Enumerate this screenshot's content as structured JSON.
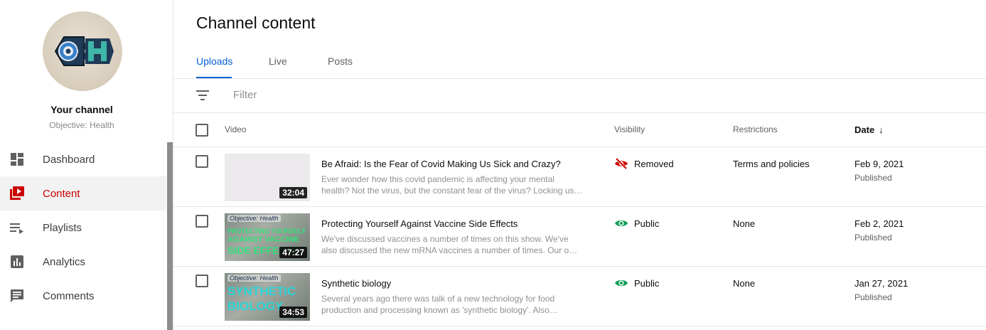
{
  "sidebar": {
    "your_channel": "Your channel",
    "channel_name": "Objective: Health",
    "items": [
      {
        "label": "Dashboard",
        "icon": "dashboard-icon"
      },
      {
        "label": "Content",
        "icon": "content-icon",
        "active": true
      },
      {
        "label": "Playlists",
        "icon": "playlists-icon"
      },
      {
        "label": "Analytics",
        "icon": "analytics-icon"
      },
      {
        "label": "Comments",
        "icon": "comments-icon"
      }
    ]
  },
  "main": {
    "title": "Channel content",
    "tabs": [
      {
        "label": "Uploads",
        "active": true
      },
      {
        "label": "Live"
      },
      {
        "label": "Posts"
      }
    ],
    "filter": {
      "placeholder": "Filter"
    },
    "columns": {
      "video": "Video",
      "visibility": "Visibility",
      "restrictions": "Restrictions",
      "date": "Date"
    },
    "videos": [
      {
        "title": "Be Afraid: Is the Fear of Covid Making Us Sick and Crazy?",
        "description_line1": "Ever wonder how this covid pandemic is affecting your mental",
        "description_line2": "health? Not the virus, but the constant fear of the virus? Locking us…",
        "duration": "32:04",
        "visibility": "Removed",
        "visibility_icon": "visibility-off-icon",
        "restrictions": "Terms and policies",
        "date": "Feb 9, 2021",
        "status": "Published"
      },
      {
        "title": "Protecting Yourself Against Vaccine Side Effects",
        "description_line1": "We've discussed vaccines a number of times on this show. We've",
        "description_line2": "also discussed the new mRNA vaccines a number of times. Our o…",
        "duration": "47:27",
        "visibility": "Public",
        "visibility_icon": "eye-icon",
        "restrictions": "None",
        "date": "Feb 2, 2021",
        "status": "Published",
        "thumb_text": [
          "PROTECTING YOURSELF",
          "AGAINST VACCINE",
          "SIDE EFFECTS"
        ]
      },
      {
        "title": "Synthetic biology",
        "description_line1": "Several years ago there was talk of a new technology for food",
        "description_line2": "production and processing known as 'synthetic biology'. Also…",
        "duration": "34:53",
        "visibility": "Public",
        "visibility_icon": "eye-icon",
        "restrictions": "None",
        "date": "Jan 27, 2021",
        "status": "Published",
        "thumb_text": [
          "SYNTHETIC",
          "BIOLOGY"
        ]
      }
    ],
    "thumb_brand": "Objective: Health"
  },
  "colors": {
    "accent_blue": "#065fd4",
    "active_red": "#cc0000",
    "removed_red": "#cc0000",
    "public_green": "#0f9d58"
  }
}
